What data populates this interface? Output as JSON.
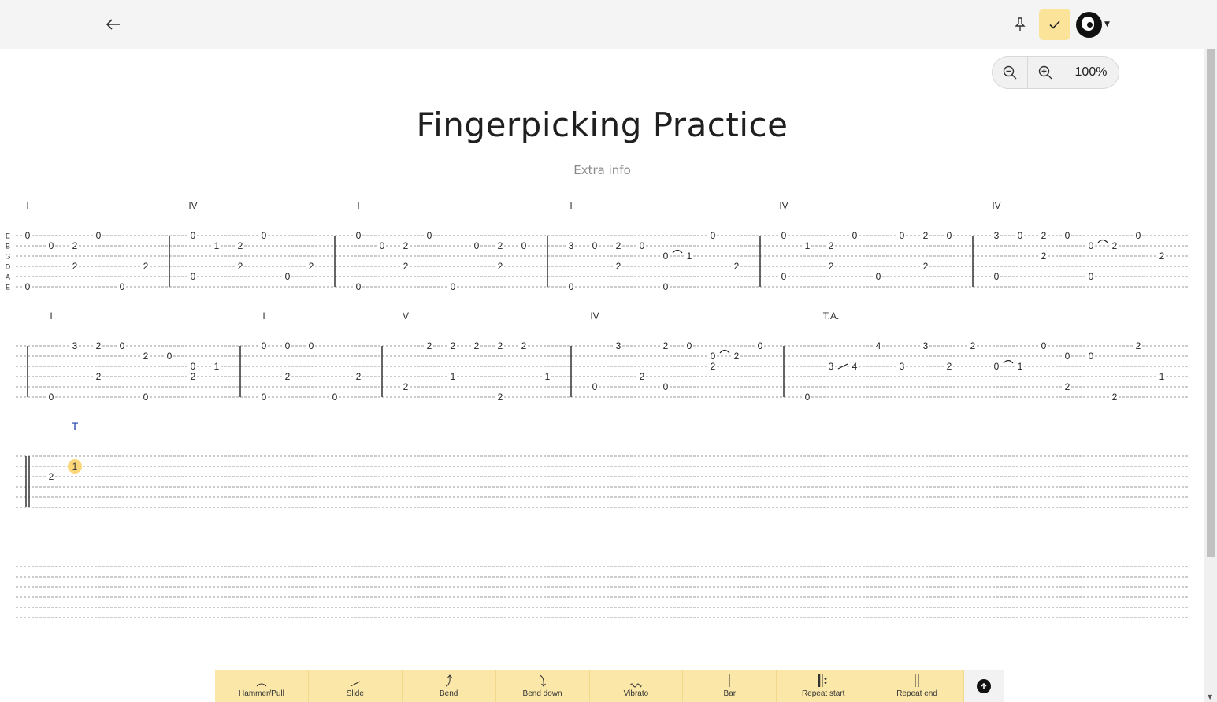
{
  "header": {
    "back_icon": "arrow-left-icon",
    "pin_icon": "pin-icon",
    "done_icon": "check-icon",
    "avatar_icon": "avatar-icon"
  },
  "zoom": {
    "level": "100%",
    "zoom_out_icon": "zoom-out-icon",
    "zoom_in_icon": "zoom-in-icon"
  },
  "song": {
    "title": "Fingerpicking Practice",
    "subtitle": "Extra info"
  },
  "tab": {
    "string_names": [
      "E",
      "B",
      "G",
      "D",
      "A",
      "E"
    ],
    "systems": [
      {
        "chords": [
          [
            "I",
            35
          ],
          [
            "IV",
            245
          ],
          [
            "I",
            455
          ],
          [
            "I",
            725
          ],
          [
            "IV",
            995
          ],
          [
            "IV",
            1265
          ]
        ],
        "bars": [
          215,
          425,
          695,
          965,
          1235
        ],
        "notes": [
          [
            35,
            0,
            "0"
          ],
          [
            125,
            0,
            "0"
          ],
          [
            65,
            1,
            "0"
          ],
          [
            95,
            1,
            "2"
          ],
          [
            95,
            3,
            "2"
          ],
          [
            185,
            3,
            "2"
          ],
          [
            35,
            5,
            "0"
          ],
          [
            155,
            5,
            "0"
          ],
          [
            245,
            0,
            "0"
          ],
          [
            335,
            0,
            "0"
          ],
          [
            275,
            1,
            "1"
          ],
          [
            305,
            1,
            "2"
          ],
          [
            305,
            3,
            "2"
          ],
          [
            395,
            3,
            "2"
          ],
          [
            245,
            4,
            "0"
          ],
          [
            365,
            4,
            "0"
          ],
          [
            455,
            0,
            "0"
          ],
          [
            545,
            0,
            "0"
          ],
          [
            485,
            1,
            "0"
          ],
          [
            515,
            1,
            "2"
          ],
          [
            605,
            1,
            "0"
          ],
          [
            635,
            1,
            "2"
          ],
          [
            665,
            1,
            "0"
          ],
          [
            515,
            3,
            "2"
          ],
          [
            635,
            3,
            "2"
          ],
          [
            455,
            5,
            "0"
          ],
          [
            575,
            5,
            "0"
          ],
          [
            905,
            0,
            "0"
          ],
          [
            725,
            1,
            "3"
          ],
          [
            755,
            1,
            "0"
          ],
          [
            785,
            1,
            "2"
          ],
          [
            815,
            1,
            "0"
          ],
          [
            845,
            2,
            "0"
          ],
          [
            875,
            2,
            "1"
          ],
          [
            785,
            3,
            "2"
          ],
          [
            935,
            3,
            "2"
          ],
          [
            725,
            5,
            "0"
          ],
          [
            845,
            5,
            "0"
          ],
          [
            995,
            0,
            "0"
          ],
          [
            1085,
            0,
            "0"
          ],
          [
            1145,
            0,
            "0"
          ],
          [
            1175,
            0,
            "2"
          ],
          [
            1205,
            0,
            "0"
          ],
          [
            1025,
            1,
            "1"
          ],
          [
            1055,
            1,
            "2"
          ],
          [
            1055,
            3,
            "2"
          ],
          [
            1175,
            3,
            "2"
          ],
          [
            995,
            4,
            "0"
          ],
          [
            1115,
            4,
            "0"
          ],
          [
            1265,
            0,
            "3"
          ],
          [
            1295,
            0,
            "0"
          ],
          [
            1325,
            0,
            "2"
          ],
          [
            1355,
            0,
            "0"
          ],
          [
            1445,
            0,
            "0"
          ],
          [
            1385,
            1,
            "0"
          ],
          [
            1415,
            1,
            "2"
          ],
          [
            1325,
            2,
            "2"
          ],
          [
            1475,
            2,
            "2"
          ],
          [
            1265,
            4,
            "0"
          ],
          [
            1385,
            4,
            "0"
          ]
        ],
        "arcs": [
          [
            860,
            2
          ],
          [
            1400,
            1
          ]
        ],
        "slides": []
      },
      {
        "chords": [
          [
            "I",
            65
          ],
          [
            "I",
            335
          ],
          [
            "V",
            515
          ],
          [
            "IV",
            755
          ],
          [
            "T.A.",
            1055
          ]
        ],
        "bars": [
          35,
          305,
          485,
          725,
          995
        ],
        "notes": [
          [
            95,
            0,
            "3"
          ],
          [
            125,
            0,
            "2"
          ],
          [
            155,
            0,
            "0"
          ],
          [
            185,
            1,
            "2"
          ],
          [
            215,
            1,
            "0"
          ],
          [
            245,
            2,
            "0"
          ],
          [
            275,
            2,
            "1"
          ],
          [
            125,
            3,
            "2"
          ],
          [
            245,
            3,
            "2"
          ],
          [
            65,
            5,
            "0"
          ],
          [
            185,
            5,
            "0"
          ],
          [
            335,
            0,
            "0"
          ],
          [
            365,
            0,
            "0"
          ],
          [
            395,
            0,
            "0"
          ],
          [
            365,
            3,
            "2"
          ],
          [
            455,
            3,
            "2"
          ],
          [
            335,
            5,
            "0"
          ],
          [
            425,
            5,
            "0"
          ],
          [
            545,
            0,
            "2"
          ],
          [
            575,
            0,
            "2"
          ],
          [
            605,
            0,
            "2"
          ],
          [
            635,
            0,
            "2"
          ],
          [
            665,
            0,
            "2"
          ],
          [
            575,
            3,
            "1"
          ],
          [
            695,
            3,
            "1"
          ],
          [
            515,
            4,
            "2"
          ],
          [
            635,
            5,
            "2"
          ],
          [
            785,
            0,
            "3"
          ],
          [
            845,
            0,
            "2"
          ],
          [
            875,
            0,
            "0"
          ],
          [
            965,
            0,
            "0"
          ],
          [
            905,
            1,
            "0"
          ],
          [
            935,
            1,
            "2"
          ],
          [
            905,
            2,
            "2"
          ],
          [
            815,
            3,
            "2"
          ],
          [
            755,
            4,
            "0"
          ],
          [
            845,
            4,
            "0"
          ],
          [
            1115,
            0,
            "4"
          ],
          [
            1175,
            0,
            "3"
          ],
          [
            1235,
            0,
            "2"
          ],
          [
            1325,
            0,
            "0"
          ],
          [
            1445,
            0,
            "2"
          ],
          [
            1355,
            1,
            "0"
          ],
          [
            1385,
            1,
            "0"
          ],
          [
            1055,
            2,
            "3"
          ],
          [
            1085,
            2,
            "4"
          ],
          [
            1145,
            2,
            "3"
          ],
          [
            1205,
            2,
            "2"
          ],
          [
            1265,
            2,
            "0"
          ],
          [
            1295,
            2,
            "1"
          ],
          [
            1475,
            3,
            "1"
          ],
          [
            1355,
            4,
            "2"
          ],
          [
            1025,
            5,
            "0"
          ],
          [
            1415,
            5,
            "2"
          ]
        ],
        "arcs": [
          [
            920,
            1
          ],
          [
            1280,
            2
          ]
        ],
        "slides": [
          [
            1070,
            2
          ]
        ]
      },
      {
        "chords": [
          [
            "T",
            95
          ]
        ],
        "bars": [],
        "notes": [
          [
            65,
            2,
            "2"
          ]
        ],
        "cursor": {
          "label": "1",
          "string": 1
        },
        "arcs": [],
        "slides": []
      },
      {
        "chords": [],
        "bars": [],
        "notes": [],
        "arcs": [],
        "slides": []
      }
    ]
  },
  "toolbar": {
    "items": [
      {
        "label": "Hammer/Pull",
        "icon": "hammer-pull-icon"
      },
      {
        "label": "Slide",
        "icon": "slide-icon"
      },
      {
        "label": "Bend",
        "icon": "bend-icon"
      },
      {
        "label": "Bend down",
        "icon": "bend-down-icon"
      },
      {
        "label": "Vibrato",
        "icon": "vibrato-icon"
      },
      {
        "label": "Bar",
        "icon": "bar-icon"
      },
      {
        "label": "Repeat start",
        "icon": "repeat-start-icon"
      },
      {
        "label": "Repeat end",
        "icon": "repeat-end-icon"
      }
    ],
    "scroll_top_icon": "arrow-up-circle-icon"
  }
}
